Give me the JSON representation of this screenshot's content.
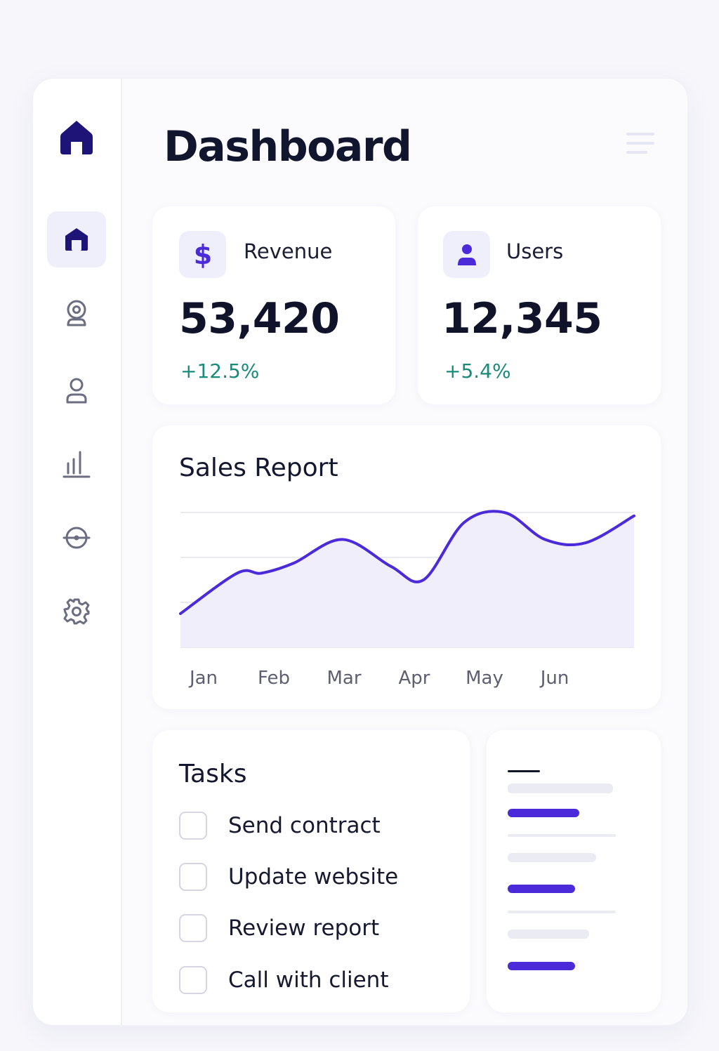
{
  "header": {
    "title": "Dashboard"
  },
  "sidebar": {
    "logo_icon": "home-icon",
    "items": [
      {
        "icon": "store-icon",
        "active": true
      },
      {
        "icon": "webcam-icon",
        "active": false
      },
      {
        "icon": "user-icon",
        "active": false
      },
      {
        "icon": "bar-chart-icon",
        "active": false
      },
      {
        "icon": "target-icon",
        "active": false
      },
      {
        "icon": "gear-icon",
        "active": false
      }
    ]
  },
  "stats": [
    {
      "label": "Revenue",
      "value": "53,420",
      "change": "+12.5%",
      "icon": "dollar-icon"
    },
    {
      "label": "Users",
      "value": "12,345",
      "change": "+5.4%",
      "icon": "user-icon"
    }
  ],
  "sales": {
    "title": "Sales Report",
    "chart_data": {
      "type": "area",
      "categories": [
        "Jan",
        "Feb",
        "Mar",
        "Apr",
        "May",
        "Jun"
      ],
      "x": [
        0,
        0.7,
        1,
        1.4,
        2,
        2.6,
        3,
        3.5,
        4,
        4.5,
        5,
        5.6
      ],
      "values": [
        1.0,
        2.2,
        2.2,
        2.5,
        3.2,
        2.4,
        2.0,
        3.7,
        4.0,
        3.2,
        3.1,
        3.9
      ],
      "ylim": [
        0,
        4.0
      ],
      "grid": true,
      "line_color": "#4b2bd9",
      "fill_color": "#efeefa"
    }
  },
  "tasks": {
    "title": "Tasks",
    "items": [
      {
        "label": "Send contract",
        "checked": false
      },
      {
        "label": "Update website",
        "checked": false
      },
      {
        "label": "Review report",
        "checked": false
      },
      {
        "label": "Call with client",
        "checked": false
      }
    ]
  },
  "colors": {
    "accent": "#4b2bd9",
    "accent_dark": "#1e1478",
    "positive": "#1a8a7a",
    "muted_bar": "#ebebf3"
  }
}
